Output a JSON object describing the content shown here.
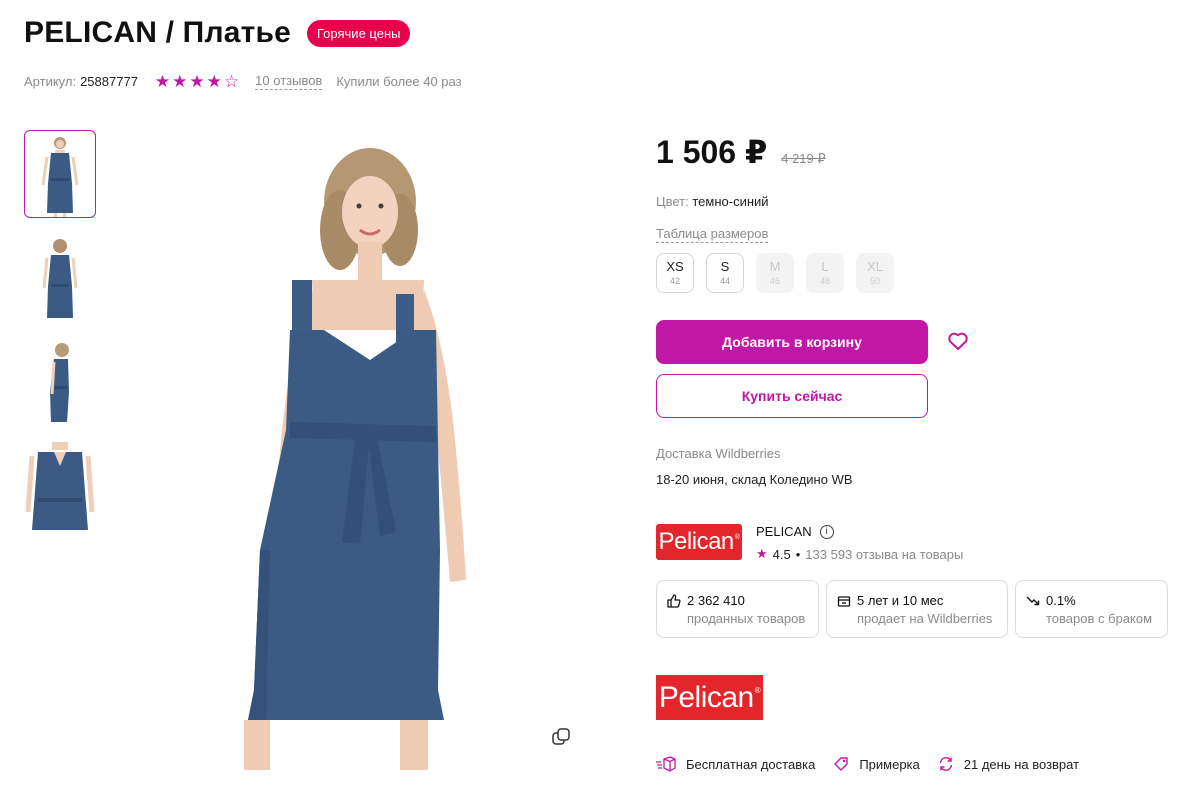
{
  "product": {
    "title": "PELICAN / Платье",
    "badge": "Горячие цены",
    "sku_label": "Артикул:",
    "sku_value": "25887777",
    "rating_stars": 4,
    "reviews": "10 отзывов",
    "bought": "Купили более 40 раз"
  },
  "price": {
    "current": "1 506 ₽",
    "old": "4 219 ₽"
  },
  "color": {
    "label": "Цвет:",
    "value": "темно-синий"
  },
  "sizes_table_link": "Таблица размеров",
  "sizes": [
    {
      "label": "XS",
      "rus": "42",
      "available": true
    },
    {
      "label": "S",
      "rus": "44",
      "available": true
    },
    {
      "label": "M",
      "rus": "46",
      "available": false
    },
    {
      "label": "L",
      "rus": "48",
      "available": false
    },
    {
      "label": "XL",
      "rus": "50",
      "available": false
    }
  ],
  "actions": {
    "add_to_cart": "Добавить в корзину",
    "buy_now": "Купить сейчас",
    "favorite_icon": "heart-icon"
  },
  "delivery": {
    "label": "Доставка Wildberries",
    "value": "18-20 июня, склад Коледино WB"
  },
  "seller": {
    "logo_text": "Pelican",
    "name": "PELICAN",
    "rating": "4.5",
    "reviews": "133 593 отзыва на товары",
    "stats": [
      {
        "icon": "thumbs-up-icon",
        "value": "2 362 410",
        "caption": "проданных товаров"
      },
      {
        "icon": "shop-icon",
        "value": "5 лет и 10 мес",
        "caption": "продает на Wildberries"
      },
      {
        "icon": "trend-down-icon",
        "value": "0.1%",
        "caption": "товаров с браком"
      }
    ]
  },
  "brand": {
    "logo_text": "Pelican"
  },
  "features": [
    {
      "icon": "box-icon",
      "label": "Бесплатная доставка"
    },
    {
      "icon": "tag-icon",
      "label": "Примерка"
    },
    {
      "icon": "return-icon",
      "label": "21 день на возврат"
    }
  ],
  "colors": {
    "accent": "#c017a6",
    "badge": "#e8004c",
    "brand_red": "#e2262b",
    "denim": "#3b5b84"
  }
}
